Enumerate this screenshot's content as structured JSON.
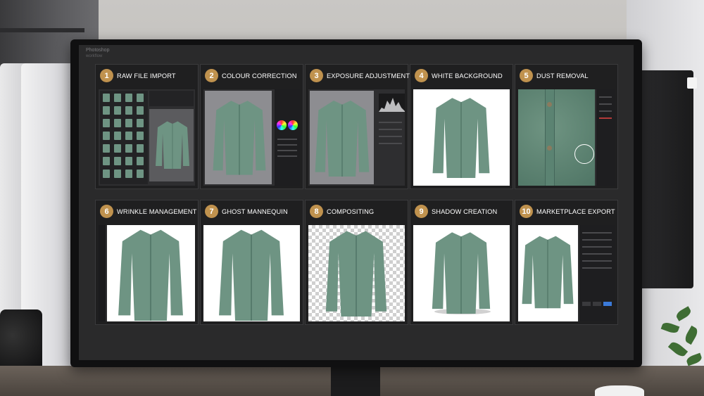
{
  "os": {
    "title": "Photoshop",
    "subtitle": "workflow"
  },
  "steps": [
    {
      "number": "1",
      "label": "RAW FILE IMPORT"
    },
    {
      "number": "2",
      "label": "COLOUR CORRECTION"
    },
    {
      "number": "3",
      "label": "EXPOSURE ADJUSTMENT"
    },
    {
      "number": "4",
      "label": "WHITE BACKGROUND"
    },
    {
      "number": "5",
      "label": "DUST REMOVAL"
    },
    {
      "number": "6",
      "label": "WRINKLE MANAGEMENT"
    },
    {
      "number": "7",
      "label": "GHOST MANNEQUIN"
    },
    {
      "number": "8",
      "label": "COMPOSITING"
    },
    {
      "number": "9",
      "label": "SHADOW CREATION"
    },
    {
      "number": "10",
      "label": "MARKETPLACE EXPORT"
    }
  ],
  "colors": {
    "badge": "#c0924e",
    "shirt": "#6e9483",
    "tile_bg": "#1f1f20",
    "screen_bg": "#2a2a2b"
  },
  "icons": [
    "shirt-icon",
    "color-wheel-icon",
    "histogram-icon",
    "brush-circle-icon",
    "checkerboard-icon"
  ]
}
